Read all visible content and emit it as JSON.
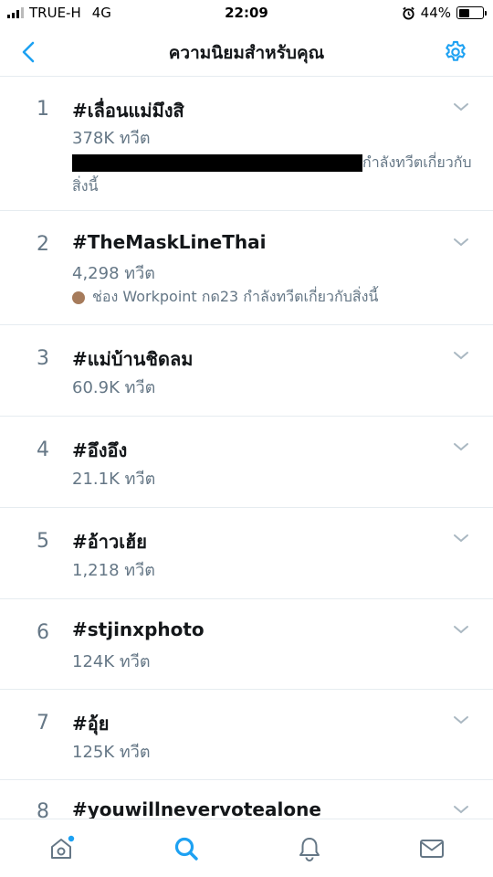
{
  "status_bar": {
    "carrier": "TRUE-H",
    "network": "4G",
    "time": "22:09",
    "battery": "44%",
    "battery_level": 0.44
  },
  "header": {
    "title": "ความนิยมสำหรับคุณ",
    "back_icon": "chevron-left-icon",
    "settings_icon": "gear-icon"
  },
  "colors": {
    "accent": "#1da1f2",
    "secondary_text": "#657786",
    "divider": "#e6ecf0"
  },
  "trends": [
    {
      "rank": "1",
      "tag": "#เลื่อนแม่มึงสิ",
      "count": "378K ทวีต",
      "context": "กำลังทวีตเกี่ยวกับสิ่งนี้",
      "context_redacted": true
    },
    {
      "rank": "2",
      "tag": "#TheMaskLineThai",
      "count": "4,298 ทวีต",
      "context": "ช่อง Workpoint กด23 กำลังทวีตเกี่ยวกับสิ่งนี้",
      "context_redacted": false
    },
    {
      "rank": "3",
      "tag": "#แม่บ้านชิดลม",
      "count": "60.9K ทวีต"
    },
    {
      "rank": "4",
      "tag": "#อึงอึง",
      "count": "21.1K ทวีต"
    },
    {
      "rank": "5",
      "tag": "#อ้าวเฮ้ย",
      "count": "1,218 ทวีต"
    },
    {
      "rank": "6",
      "tag": "#stjinxphoto",
      "count": "124K ทวีต"
    },
    {
      "rank": "7",
      "tag": "#อุ้ย",
      "count": "125K ทวีต"
    },
    {
      "rank": "8",
      "tag": "#youwillnevervotealone"
    }
  ],
  "tab_bar": {
    "items": [
      "home-icon",
      "search-icon",
      "notifications-icon",
      "messages-icon"
    ],
    "active": "search-icon"
  }
}
